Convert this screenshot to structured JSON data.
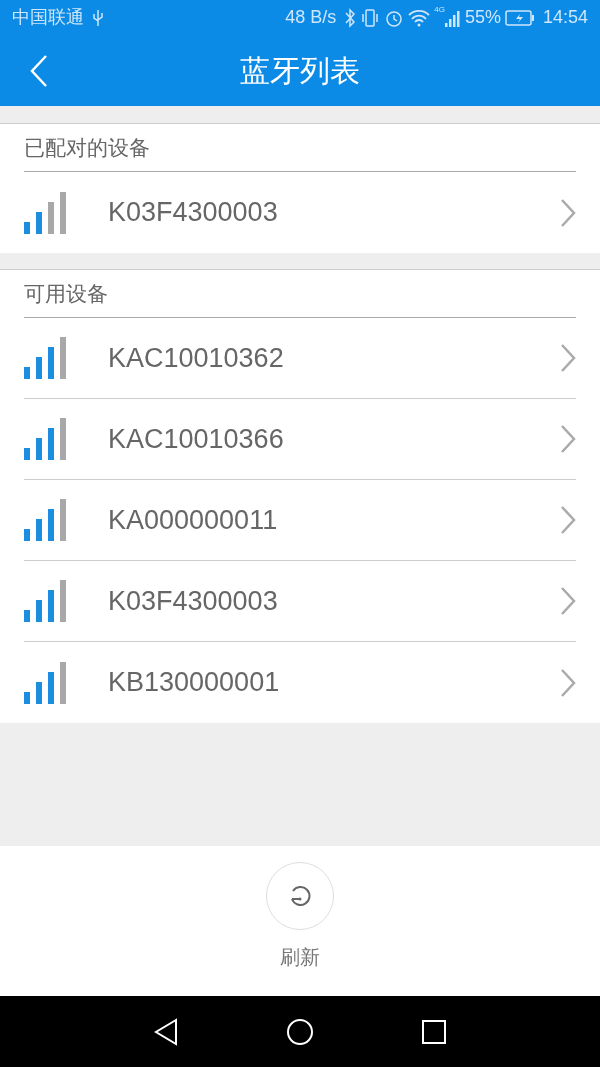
{
  "status_bar": {
    "carrier": "中国联通",
    "speed": "48 B/s",
    "network": "4G",
    "battery": "55%",
    "time": "14:54"
  },
  "header": {
    "title": "蓝牙列表"
  },
  "sections": [
    {
      "title": "已配对的设备",
      "devices": [
        {
          "name": "K03F4300003",
          "kind": "weak"
        }
      ]
    },
    {
      "title": "可用设备",
      "devices": [
        {
          "name": "KAC10010362",
          "kind": "fair"
        },
        {
          "name": "KAC10010366",
          "kind": "fair"
        },
        {
          "name": "KA000000011",
          "kind": "fair"
        },
        {
          "name": "K03F4300003",
          "kind": "fair"
        },
        {
          "name": "KB130000001",
          "kind": "fair"
        }
      ]
    }
  ],
  "refresh": {
    "label": "刷新"
  }
}
